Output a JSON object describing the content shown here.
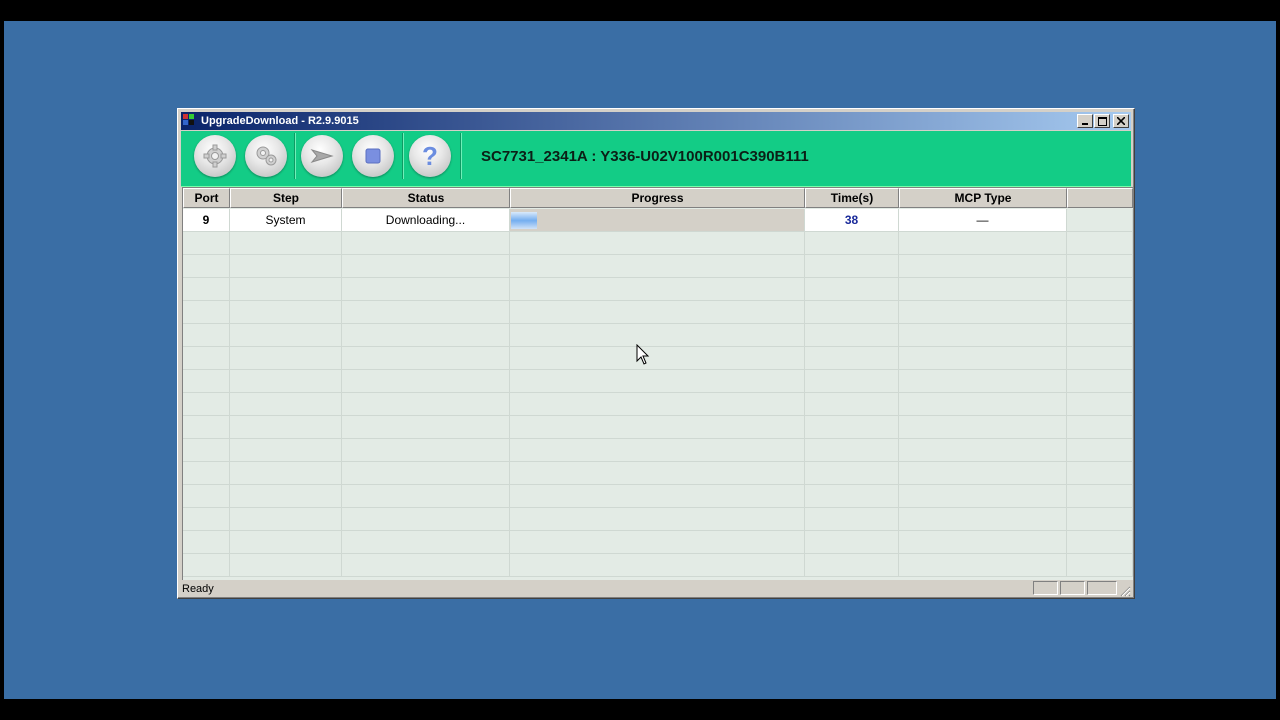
{
  "window": {
    "title": "UpgradeDownload - R2.9.9015",
    "controls": {
      "minimize": "_",
      "maximize": "□",
      "close": "✕"
    }
  },
  "toolbar": {
    "buttons": [
      {
        "name": "settings",
        "icon": "gear-icon"
      },
      {
        "name": "load-packet",
        "icon": "gears-icon"
      },
      {
        "name": "start",
        "icon": "play-arrow-icon"
      },
      {
        "name": "stop",
        "icon": "stop-square-icon"
      },
      {
        "name": "help",
        "icon": "question-mark-icon",
        "glyph": "?"
      }
    ],
    "firmware_label": "SC7731_2341A : Y336-U02V100R001C390B111",
    "background_color": "#13cc86"
  },
  "grid": {
    "columns": [
      "Port",
      "Step",
      "Status",
      "Progress",
      "Time(s)",
      "MCP Type"
    ],
    "rows": [
      {
        "port": "9",
        "step": "System",
        "status": "Downloading...",
        "progress_fraction": 0.09,
        "time": "38",
        "mcp_type": "—"
      }
    ]
  },
  "statusbar": {
    "text": "Ready"
  }
}
